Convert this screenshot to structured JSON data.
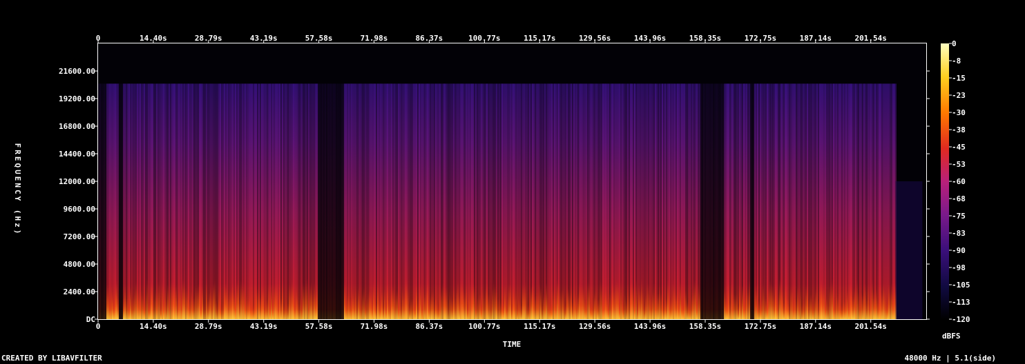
{
  "chart_data": {
    "type": "heatmap",
    "title": "",
    "xlabel": "TIME",
    "ylabel": "FREQUENCY (Hz)",
    "x_ticks": [
      "0",
      "14.40s",
      "28.79s",
      "43.19s",
      "57.58s",
      "71.98s",
      "86.37s",
      "100.77s",
      "115.17s",
      "129.56s",
      "143.96s",
      "158.35s",
      "172.75s",
      "187.14s",
      "201.54s"
    ],
    "x_tick_values": [
      0,
      14.4,
      28.79,
      43.19,
      57.58,
      71.98,
      86.37,
      100.77,
      115.17,
      129.56,
      143.96,
      158.35,
      172.75,
      187.14,
      201.54
    ],
    "xlim": [
      0,
      216
    ],
    "y_ticks": [
      "DC",
      "2400.00",
      "4800.00",
      "7200.00",
      "9600.00",
      "12000.00",
      "14400.00",
      "16800.00",
      "19200.00",
      "21600.00"
    ],
    "y_tick_values": [
      0,
      2400,
      4800,
      7200,
      9600,
      12000,
      14400,
      16800,
      19200,
      21600
    ],
    "ylim": [
      0,
      24000
    ],
    "colorbar": {
      "label": "dBFS",
      "ticks": [
        "0",
        "-8",
        "-15",
        "-23",
        "-30",
        "-38",
        "-45",
        "-53",
        "-60",
        "-68",
        "-75",
        "-83",
        "-90",
        "-98",
        "-105",
        "-113",
        "-120"
      ],
      "range": [
        -120,
        0
      ],
      "colors": [
        "#000000",
        "#100a40",
        "#3a0f7a",
        "#7a1a8a",
        "#b8207a",
        "#e02a20",
        "#ff7a00",
        "#ffd020",
        "#ffffc0"
      ]
    },
    "approx_cutoff_hz": 20500,
    "approx_audio_end_s": 208,
    "silent_gaps_s": [
      [
        0,
        2
      ],
      [
        5.2,
        6.2
      ],
      [
        57,
        64
      ],
      [
        157,
        163
      ],
      [
        170,
        171
      ]
    ]
  },
  "footer": {
    "left": "CREATED BY LIBAVFILTER",
    "right": "48000 Hz | 5.1(side)"
  }
}
